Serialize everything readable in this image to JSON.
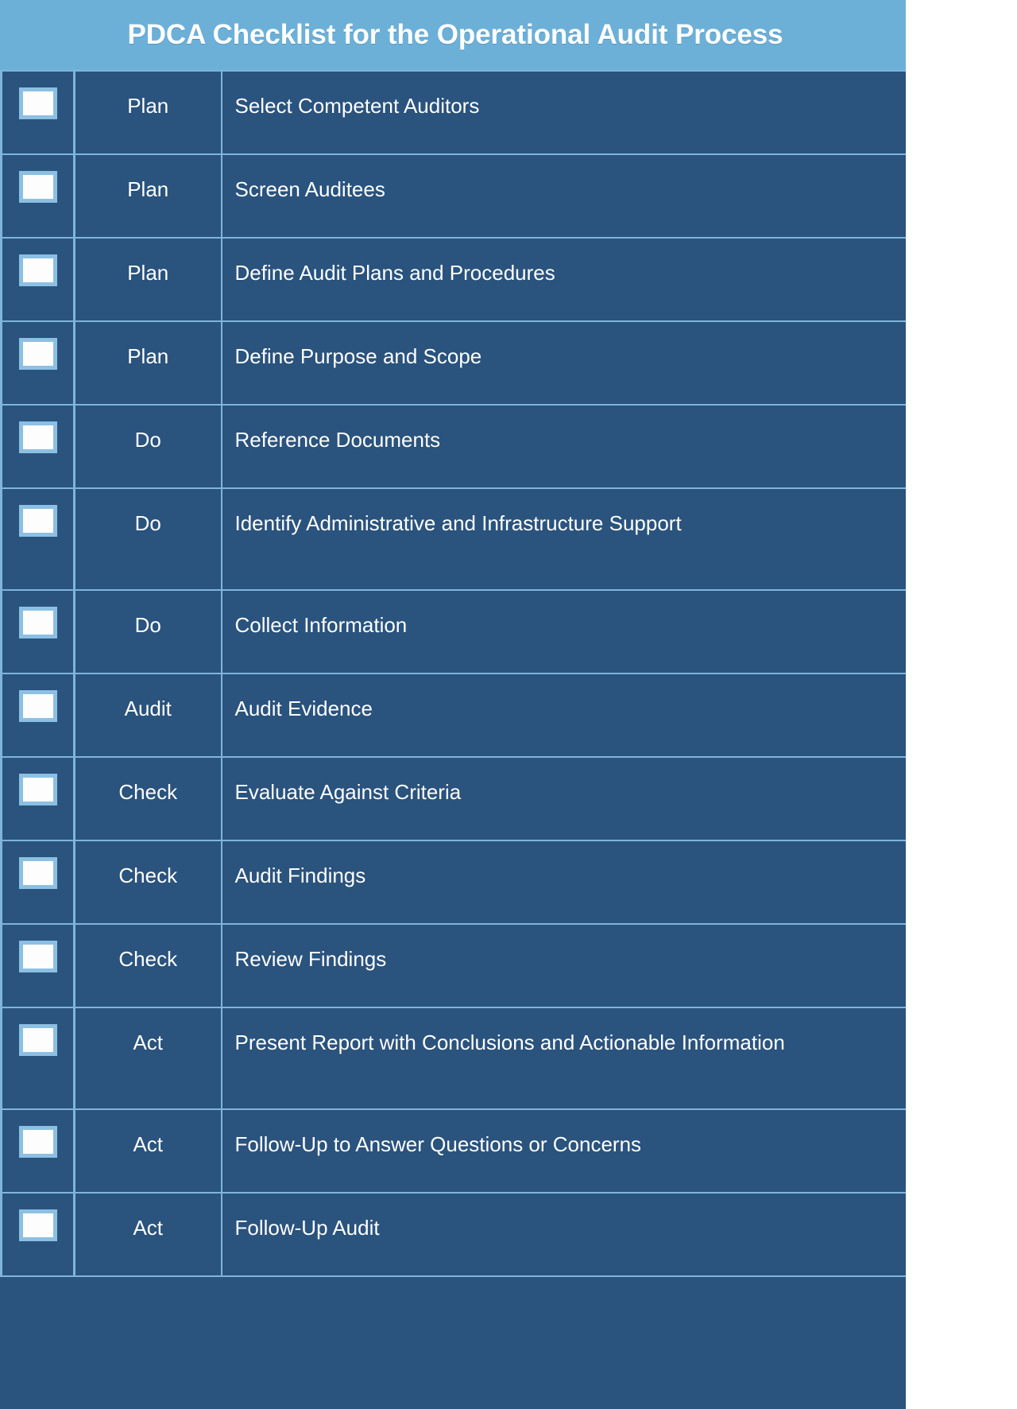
{
  "header": {
    "title": "PDCA Checklist for the Operational Audit Process",
    "bg_color": "#6cb0d8",
    "text_color": "#ffffff"
  },
  "theme": {
    "cell_bg": "#2a537e",
    "grid_line": "#7fb5da",
    "checkbox_fill": "#fdfdfd",
    "checkbox_border": "#8cc0e3",
    "text_color": "#ffffff"
  },
  "columns": {
    "checkbox": "",
    "phase": "",
    "task": ""
  },
  "rows": [
    {
      "checked": false,
      "phase": "Plan",
      "task": "Select Competent Auditors"
    },
    {
      "checked": false,
      "phase": "Plan",
      "task": "Screen Auditees"
    },
    {
      "checked": false,
      "phase": "Plan",
      "task": "Define Audit Plans and Procedures"
    },
    {
      "checked": false,
      "phase": "Plan",
      "task": "Define Purpose and Scope"
    },
    {
      "checked": false,
      "phase": "Do",
      "task": "Reference Documents"
    },
    {
      "checked": false,
      "phase": "Do",
      "task": "Identify Administrative and Infrastructure Support"
    },
    {
      "checked": false,
      "phase": "Do",
      "task": "Collect Information"
    },
    {
      "checked": false,
      "phase": "Audit",
      "task": "Audit Evidence"
    },
    {
      "checked": false,
      "phase": "Check",
      "task": "Evaluate Against Criteria"
    },
    {
      "checked": false,
      "phase": "Check",
      "task": "Audit Findings"
    },
    {
      "checked": false,
      "phase": "Check",
      "task": "Review Findings"
    },
    {
      "checked": false,
      "phase": "Act",
      "task": "Present Report with Conclusions and Actionable Information"
    },
    {
      "checked": false,
      "phase": "Act",
      "task": "Follow-Up to Answer Questions or Concerns"
    },
    {
      "checked": false,
      "phase": "Act",
      "task": "Follow-Up Audit"
    }
  ]
}
